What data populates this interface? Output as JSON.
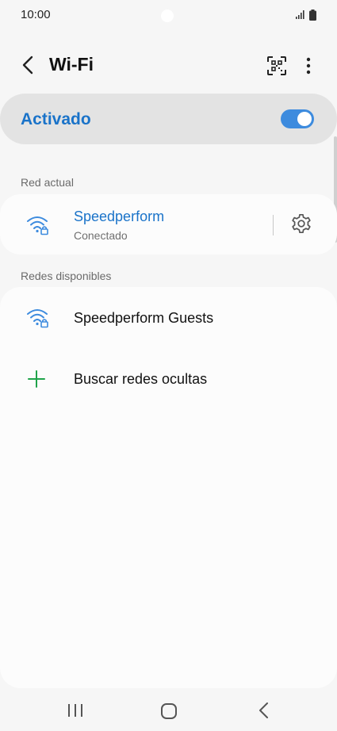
{
  "status_bar": {
    "time": "10:00"
  },
  "header": {
    "title": "Wi-Fi"
  },
  "master_switch": {
    "label": "Activado",
    "enabled": true
  },
  "current_network": {
    "section_title": "Red actual",
    "name": "Speedperform",
    "status": "Conectado"
  },
  "available_networks": {
    "section_title": "Redes disponibles",
    "items": [
      {
        "name": "Speedperform Guests"
      }
    ],
    "hidden_networks_label": "Buscar redes ocultas"
  },
  "colors": {
    "accent": "#1a73c9",
    "toggle_on": "#3d8bde",
    "add_green": "#1fa34a"
  },
  "icons": [
    "back-arrow-icon",
    "qr-scan-icon",
    "more-vert-icon",
    "wifi-lock-icon",
    "gear-icon",
    "plus-icon",
    "recents-icon",
    "home-icon",
    "nav-back-icon"
  ]
}
